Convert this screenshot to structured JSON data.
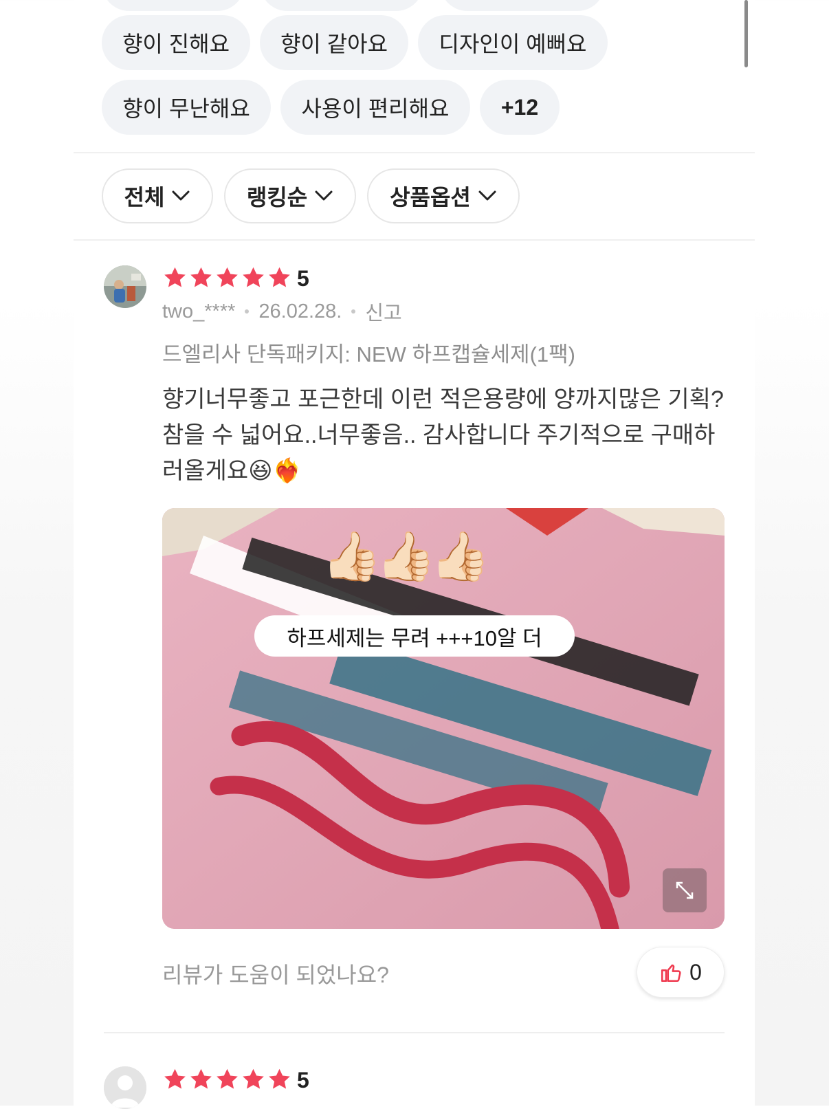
{
  "keyword_chips": {
    "row1": [
      "향이 진해요",
      "향이 같아요",
      "디자인이 예뻐요"
    ],
    "row2": [
      "향이 무난해요",
      "사용이 편리해요"
    ],
    "more_label": "+12"
  },
  "filters": [
    {
      "label": "전체",
      "icon": "chevron-down-icon"
    },
    {
      "label": "랭킹순",
      "icon": "chevron-down-icon"
    },
    {
      "label": "상품옵션",
      "icon": "chevron-down-icon"
    }
  ],
  "reviews": [
    {
      "rating": 5,
      "score_label": "5",
      "author": "two_****",
      "date": "26.02.28.",
      "report_label": "신고",
      "option": "드엘리사 단독패키지: NEW 하프캡슐세제(1팩)",
      "text": "향기너무좋고 포근한데 이런 적은용량에 양까지많은 기획? 참을 수 넓어요..너무좋음.. 감사합니다 주기적으로 구매하러올게요😆❤️‍🔥",
      "photo": {
        "caption": "하프세제는 무려 +++10알 더",
        "sticker": "👍🏻👍🏻👍🏻",
        "expand_icon": "expand-icon"
      },
      "helpful_question": "리뷰가 도움이 되었나요?",
      "like_count": "0",
      "like_icon": "thumbs-up-icon"
    },
    {
      "rating": 5,
      "score_label": "5"
    }
  ],
  "colors": {
    "star": "#f0445a",
    "chip_bg": "#f1f3f6",
    "like_icon": "#ef3a4f"
  }
}
